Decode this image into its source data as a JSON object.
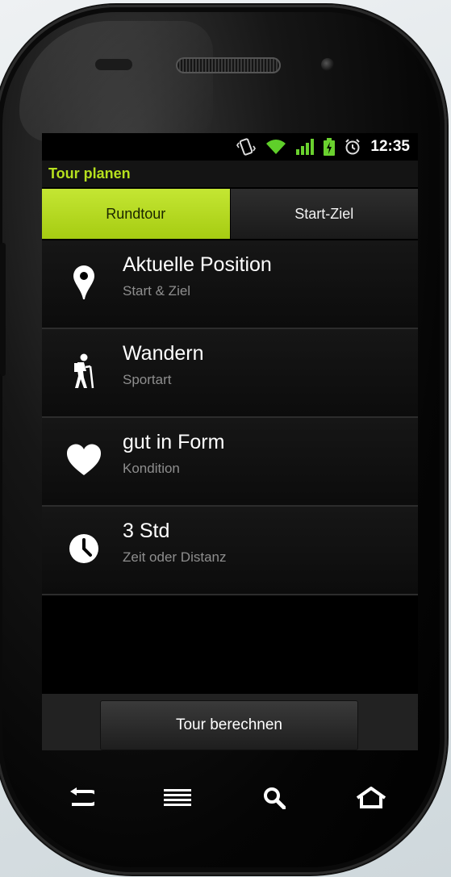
{
  "status": {
    "time": "12:35"
  },
  "header": {
    "title": "Tour planen"
  },
  "tabs": [
    {
      "label": "Rundtour",
      "selected": true
    },
    {
      "label": "Start-Ziel",
      "selected": false
    }
  ],
  "options": [
    {
      "icon": "location-pin-icon",
      "title": "Aktuelle Position",
      "subtitle": "Start & Ziel"
    },
    {
      "icon": "hiker-icon",
      "title": "Wandern",
      "subtitle": "Sportart"
    },
    {
      "icon": "heart-icon",
      "title": "gut in Form",
      "subtitle": "Kondition"
    },
    {
      "icon": "clock-icon",
      "title": "3 Std",
      "subtitle": "Zeit oder Distanz"
    }
  ],
  "actions": {
    "calculate_label": "Tour berechnen"
  },
  "colors": {
    "accent": "#b6e01e",
    "tab_active": "#a6cc12",
    "background": "#000000"
  }
}
